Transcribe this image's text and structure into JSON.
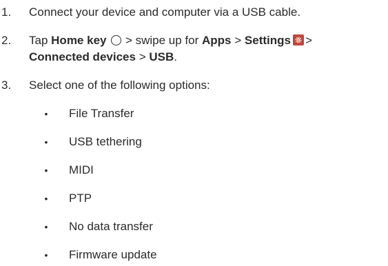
{
  "steps": [
    {
      "number": "1.",
      "text": "Connect your device and computer via a USB cable."
    },
    {
      "number": "2.",
      "tap": "Tap",
      "home_key": "Home key",
      "swipe": "> swipe up for",
      "apps": "Apps",
      "sep1": ">",
      "settings": "Settings",
      "sep2": ">",
      "connected_devices": "Connected devices",
      "sep3": ">",
      "usb": "USB",
      "period": "."
    },
    {
      "number": "3.",
      "text": "Select one of the following options:"
    }
  ],
  "options": [
    "File Transfer",
    "USB tethering",
    "MIDI",
    "PTP",
    "No data transfer",
    "Firmware update"
  ],
  "bullet_char": "•",
  "icons": {
    "home_key": "circle-outline-icon",
    "settings": "gear-icon",
    "settings_color": "#c2453a"
  }
}
